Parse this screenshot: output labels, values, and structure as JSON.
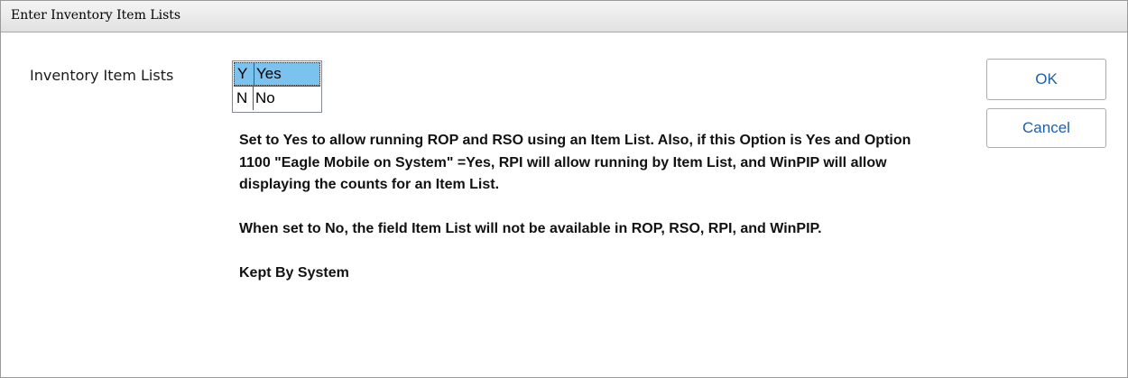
{
  "window": {
    "title": "Enter Inventory Item Lists"
  },
  "field": {
    "label": "Inventory Item Lists"
  },
  "options": [
    {
      "code": "Y",
      "label": "Yes",
      "selected": true
    },
    {
      "code": "N",
      "label": "No",
      "selected": false
    }
  ],
  "description": {
    "paragraph1": "Set to Yes to allow running ROP and RSO using an Item List. Also, if this Option is Yes and Option 1100 \"Eagle Mobile on System\" =Yes, RPI will allow running by Item List, and WinPIP will allow displaying the counts for an Item List.",
    "paragraph2": "When set to No, the field Item List will not be available in ROP, RSO, RPI, and WinPIP.",
    "paragraph3": "Kept By System"
  },
  "buttons": {
    "ok": "OK",
    "cancel": "Cancel"
  },
  "colors": {
    "selection": "#7cc2ee",
    "button_text": "#1f5fa8"
  }
}
